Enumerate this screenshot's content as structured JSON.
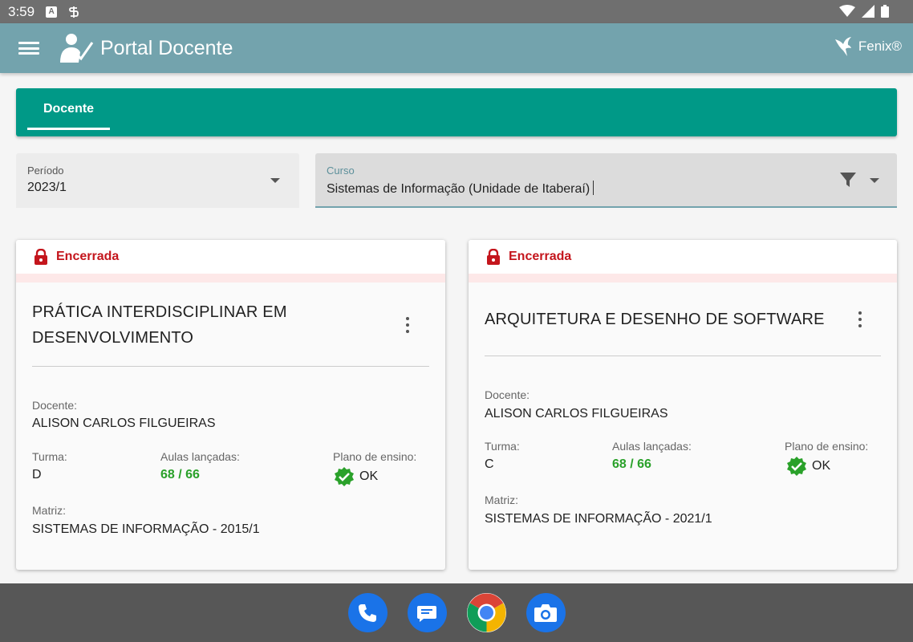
{
  "status_bar": {
    "time": "3:59",
    "icon_a": "A",
    "icon_b": "S"
  },
  "app_bar": {
    "title": "Portal Docente",
    "brand": "Fenix®",
    "menu_icon": "hamburger-menu-icon",
    "logo_icon": "teacher-icon"
  },
  "tabs": [
    {
      "label": "Docente",
      "active": true
    }
  ],
  "filters": {
    "periodo": {
      "label": "Período",
      "value": "2023/1"
    },
    "curso": {
      "label": "Curso",
      "value": "Sistemas de Informação (Unidade de Itaberaí)"
    }
  },
  "labels": {
    "docente": "Docente:",
    "turma": "Turma:",
    "aulas": "Aulas lançadas:",
    "plano": "Plano de ensino:",
    "matriz": "Matriz:"
  },
  "cards": [
    {
      "status": "Encerrada",
      "title": "PRÁTICA INTERDISCIPLINAR EM DESENVOLVIMENTO",
      "docente": "ALISON CARLOS FILGUEIRAS",
      "turma": "D",
      "aulas": "68 / 66",
      "plano": "OK",
      "matriz": "SISTEMAS DE INFORMAÇÃO - 2015/1"
    },
    {
      "status": "Encerrada",
      "title": "ARQUITETURA E DESENHO DE SOFTWARE",
      "docente": "ALISON CARLOS FILGUEIRAS",
      "turma": "C",
      "aulas": "68 / 66",
      "plano": "OK",
      "matriz": "SISTEMAS DE INFORMAÇÃO - 2021/1"
    }
  ],
  "dock": [
    "phone-icon",
    "messages-icon",
    "chrome-icon",
    "camera-icon"
  ],
  "colors": {
    "appbar": "#73a3ad",
    "tab": "#009987",
    "status_red": "#c4151c",
    "ok_green": "#2aa12a"
  }
}
